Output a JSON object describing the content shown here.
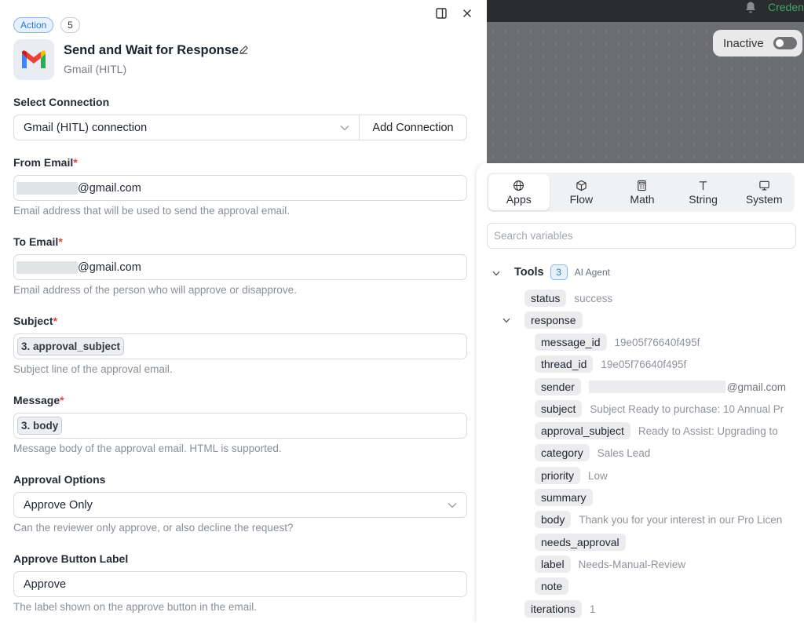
{
  "topbar": {
    "credentials_label": "Credent"
  },
  "canvas": {
    "status_label": "Inactive"
  },
  "node": {
    "type_badge": "Action",
    "step_number": "5",
    "title": "Send and Wait for Response",
    "app_name": "Gmail (HITL)"
  },
  "form": {
    "connection": {
      "label": "Select Connection",
      "value": "Gmail (HITL) connection",
      "add_button": "Add Connection"
    },
    "from_email": {
      "label": "From Email",
      "required_mark": "*",
      "value": "@gmail.com",
      "help": "Email address that will be used to send the approval email."
    },
    "to_email": {
      "label": "To Email",
      "required_mark": "*",
      "value": "@gmail.com",
      "help": "Email address of the person who will approve or disapprove."
    },
    "subject": {
      "label": "Subject",
      "required_mark": "*",
      "chip": "3. approval_subject",
      "help": "Subject line of the approval email."
    },
    "message": {
      "label": "Message",
      "required_mark": "*",
      "chip": "3. body",
      "help": "Message body of the approval email. HTML is supported."
    },
    "approval_options": {
      "label": "Approval Options",
      "value": "Approve Only",
      "help": "Can the reviewer only approve, or also decline the request?"
    },
    "approve_label": {
      "label": "Approve Button Label",
      "value": "Approve",
      "help": "The label shown on the approve button in the email."
    }
  },
  "variables": {
    "tabs": [
      {
        "label": "Apps",
        "icon": "globe-icon"
      },
      {
        "label": "Flow",
        "icon": "cube-icon"
      },
      {
        "label": "Math",
        "icon": "calculator-icon"
      },
      {
        "label": "String",
        "icon": "text-icon"
      },
      {
        "label": "System",
        "icon": "monitor-icon"
      }
    ],
    "search_placeholder": "Search variables",
    "group": {
      "label": "Tools",
      "count": "3",
      "source": "AI Agent"
    },
    "items": {
      "status": {
        "key": "status",
        "value": "success"
      },
      "response": {
        "key": "response"
      },
      "message_id": {
        "key": "message_id",
        "value": "19e05f76640f495f"
      },
      "thread_id": {
        "key": "thread_id",
        "value": "19e05f76640f495f"
      },
      "sender": {
        "key": "sender",
        "value": "@gmail.com"
      },
      "subject": {
        "key": "subject",
        "value": "Subject Ready to purchase: 10 Annual Pr"
      },
      "approval_subject": {
        "key": "approval_subject",
        "value": "Ready to Assist: Upgrading to"
      },
      "category": {
        "key": "category",
        "value": "Sales Lead"
      },
      "priority": {
        "key": "priority",
        "value": "Low"
      },
      "summary": {
        "key": "summary"
      },
      "body": {
        "key": "body",
        "value": "Thank you for your interest in our Pro Licen"
      },
      "needs_approval": {
        "key": "needs_approval"
      },
      "label": {
        "key": "label",
        "value": "Needs-Manual-Review"
      },
      "note": {
        "key": "note"
      },
      "iterations": {
        "key": "iterations",
        "value": "1"
      }
    }
  },
  "colors": {
    "accent": "#2a78d4",
    "required": "#e0453c",
    "canvas": "#6d6e71",
    "topbar": "#2b2c2e",
    "credent": "#3fa56b"
  }
}
